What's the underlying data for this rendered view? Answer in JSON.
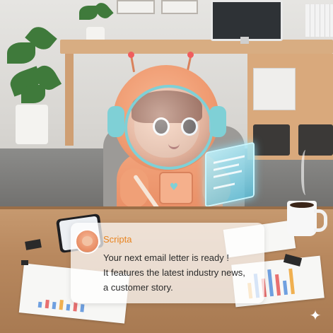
{
  "notification": {
    "sender": "Scripta",
    "lines": [
      "Your next email letter is ready !",
      "It features the latest industry news,",
      "a customer story."
    ]
  },
  "icons": {
    "avatar": "astronaut-avatar-icon",
    "sparkle": "sparkle-icon",
    "heart": "heart-icon"
  },
  "colors": {
    "sender_name": "#e8841f",
    "suit": "#ef9a70",
    "accent": "#7fd0d6"
  }
}
